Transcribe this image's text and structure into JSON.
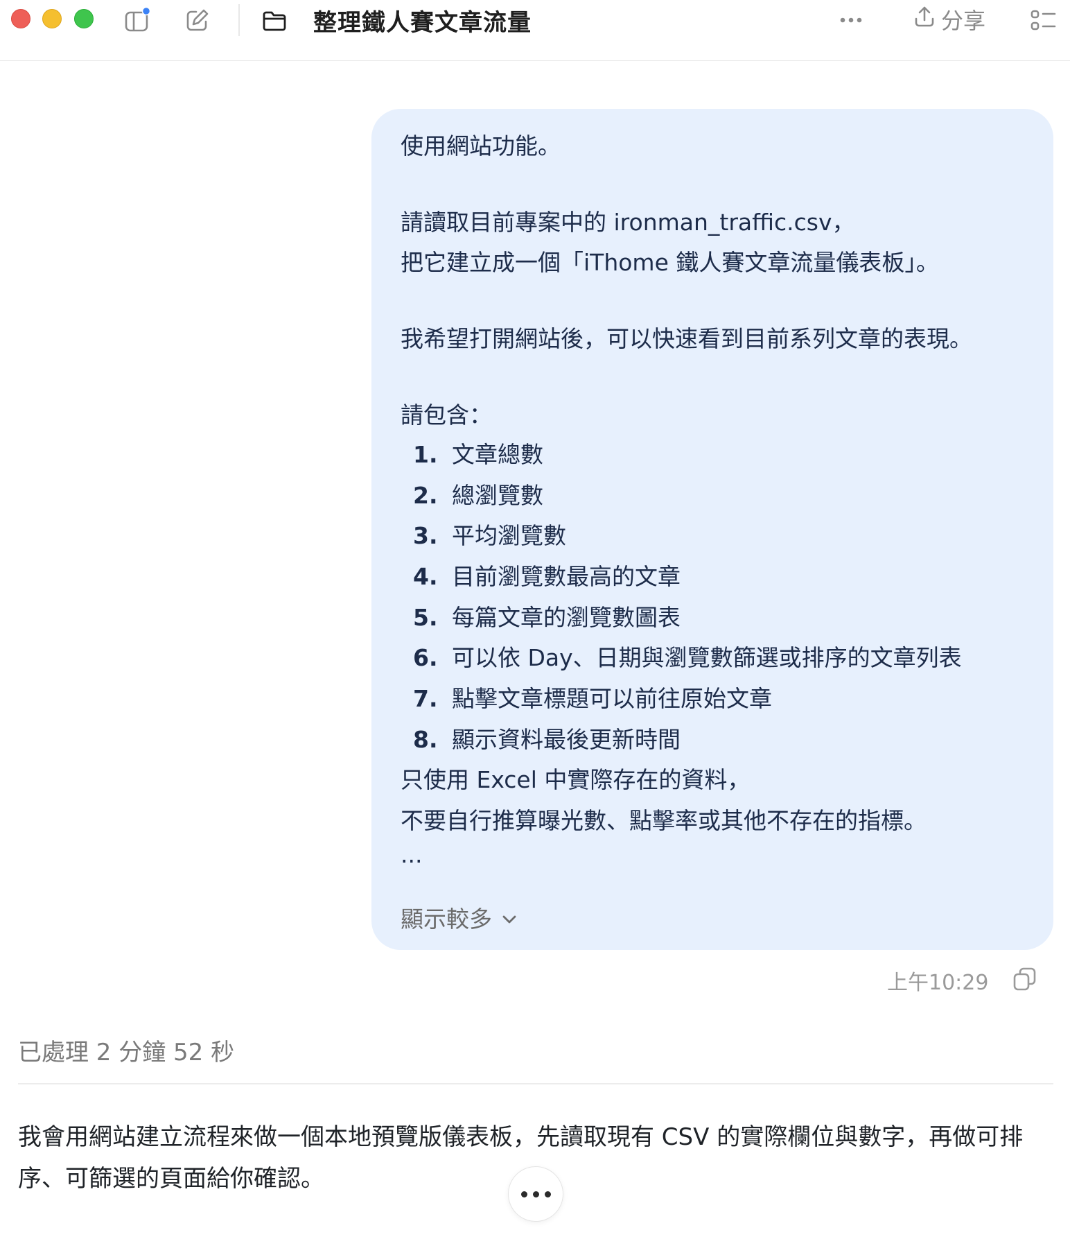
{
  "window": {
    "title": "整理鐵人賽文章流量",
    "share_label": "分享"
  },
  "bubble": {
    "line1": "使用網站功能。",
    "line2": "請讀取目前專案中的 ironman_traffic.csv，",
    "line3": "把它建立成一個「iThome 鐵人賽文章流量儀表板」。",
    "line4": "我希望打開網站後，可以快速看到目前系列文章的表現。",
    "include_label": "請包含：",
    "items": [
      {
        "num": "1.",
        "text": "文章總數"
      },
      {
        "num": "2.",
        "text": "總瀏覽數"
      },
      {
        "num": "3.",
        "text": "平均瀏覽數"
      },
      {
        "num": "4.",
        "text": "目前瀏覽數最高的文章"
      },
      {
        "num": "5.",
        "text": "每篇文章的瀏覽數圖表"
      },
      {
        "num": "6.",
        "text": "可以依 Day、日期與瀏覽數篩選或排序的文章列表"
      },
      {
        "num": "7.",
        "text": "點擊文章標題可以前往原始文章"
      },
      {
        "num": "8.",
        "text": "顯示資料最後更新時間"
      }
    ],
    "line5": "只使用 Excel 中實際存在的資料，",
    "line6": "不要自行推算曝光數、點擊率或其他不存在的指標。",
    "ellipsis": "...",
    "show_more": "顯示較多"
  },
  "meta": {
    "timestamp": "上午10:29"
  },
  "assistant": {
    "processed": "已處理 2 分鐘 52 秒",
    "reply": "我會用網站建立流程來做一個本地預覽版儀表板，先讀取現有 CSV 的實際欄位與數字，再做可排序、可篩選的頁面給你確認。"
  },
  "icons": {
    "sidebar": "sidebar-toggle-icon",
    "compose": "compose-icon",
    "folder": "folder-icon",
    "more": "more-horizontal-icon",
    "share": "upload-icon",
    "panel": "list-panel-icon",
    "copy": "copy-icon",
    "chevron": "chevron-down-icon"
  },
  "colors": {
    "bubble_bg": "#e7f0fd",
    "notification_dot": "#3b82f6"
  }
}
